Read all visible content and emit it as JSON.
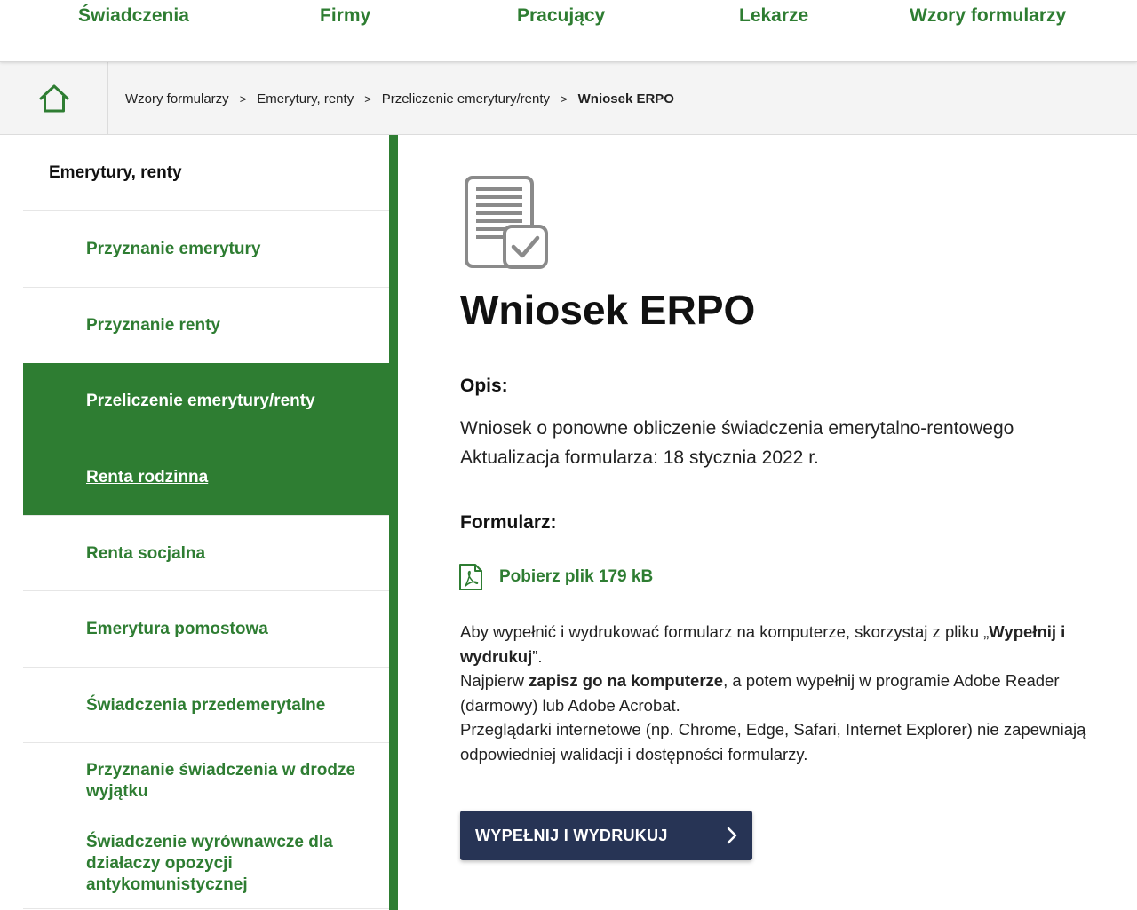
{
  "topnav": {
    "items": [
      "Świadczenia",
      "Firmy",
      "Pracujący",
      "Lekarze",
      "Wzory formularzy"
    ]
  },
  "breadcrumb": {
    "items": [
      "Wzory formularzy",
      "Emerytury, renty",
      "Przeliczenie emerytury/renty"
    ],
    "separator": ">",
    "current": "Wniosek ERPO"
  },
  "sidebar": {
    "heading": "Emerytury, renty",
    "items": [
      "Przyznanie emerytury",
      "Przyznanie renty",
      "Przeliczenie emerytury/renty",
      "Renta rodzinna",
      "Renta socjalna",
      "Emerytura pomostowa",
      "Świadczenia przedemerytalne",
      "Przyznanie świadczenia w drodze wyjątku",
      "Świadczenie wyrównawcze dla działaczy opozycji antykomunistycznej"
    ]
  },
  "main": {
    "title": "Wniosek ERPO",
    "opis_label": "Opis:",
    "description_line1": "Wniosek o ponowne obliczenie świadczenia emerytalno-rentowego",
    "description_line2": "Aktualizacja formularza: 18 stycznia 2022 r.",
    "form_label": "Formularz:",
    "download_text": "Pobierz plik 179 kB",
    "info": {
      "p1_a": "Aby wypełnić i wydrukować formularz na komputerze, skorzystaj z pliku „",
      "p1_b": "Wypełnij i wydrukuj",
      "p1_c": "”.",
      "p2_a": "Najpierw ",
      "p2_b": "zapisz go na komputerze",
      "p2_c": ", a potem wypełnij w programie Adobe Reader (darmowy) lub Adobe Acrobat.",
      "p3": "Przeglądarki internetowe (np. Chrome, Edge, Safari, Internet Explorer) nie zapewniają odpowiedniej walidacji i dostępności formularzy."
    },
    "fill_button_label": "WYPEŁNIJ I WYDRUKUJ"
  },
  "colors": {
    "brand_green": "#2e7d32",
    "button_navy": "#273455",
    "icon_gray": "#8a8a8a"
  }
}
